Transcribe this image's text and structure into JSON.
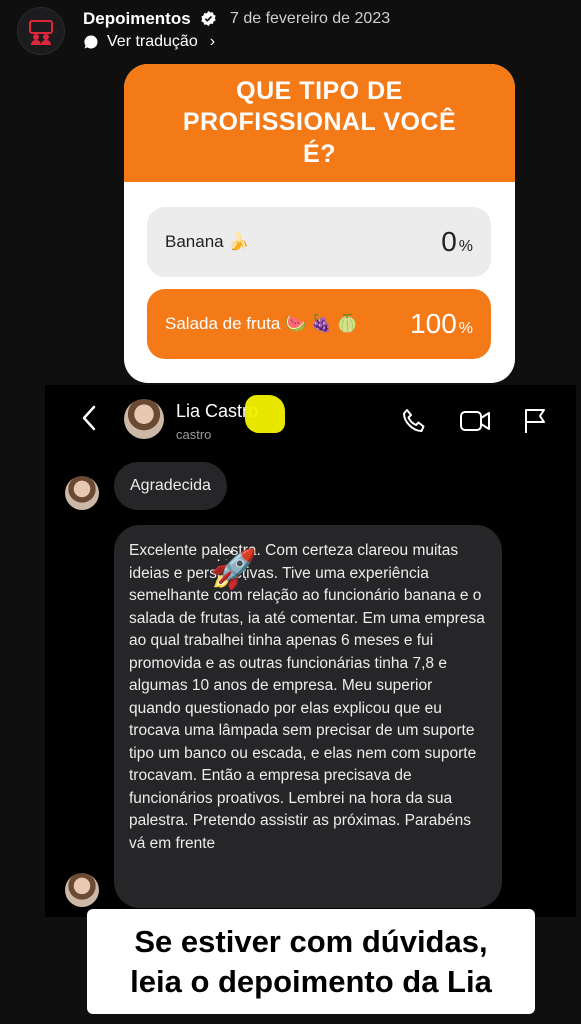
{
  "header": {
    "account_name": "Depoimentos",
    "date": "7 de fevereiro de 2023",
    "translate_label": "Ver tradução"
  },
  "poll": {
    "question": "QUE TIPO DE PROFISSIONAL VOCÊ É?",
    "options": [
      {
        "label": "Banana 🍌",
        "percent": "0",
        "percent_sign": "%"
      },
      {
        "label": "Salada de fruta 🍉 🍇 🍈",
        "percent": "100",
        "percent_sign": "%"
      }
    ],
    "accent": "#f47a18"
  },
  "chat": {
    "contact_name": "Lia Castro",
    "username": "castro",
    "messages": [
      {
        "text": "Agradecida"
      },
      {
        "text": "Excelente palestra. Com certeza clareou muitas ideias e perspectivas. Tive uma experiência semelhante com relação ao funcionário banana e o salada de frutas, ia até comentar. Em uma empresa ao qual trabalhei tinha apenas 6 meses e fui promovida e as outras funcionárias tinha 7,8 e algumas 10 anos de empresa. Meu superior quando questionado por elas explicou que eu trocava uma lâmpada sem precisar de um suporte tipo um banco ou escada, e elas nem com suporte trocavam. Então a empresa precisava de funcionários proativos. Lembrei na hora da sua palestra. Pretendo assistir as próximas. Parabéns vá em frente"
      }
    ],
    "sticker_emoji": "🚀"
  },
  "caption": {
    "line1": "Se estiver com dúvidas,",
    "line2": "leia o depoimento da Lia"
  }
}
